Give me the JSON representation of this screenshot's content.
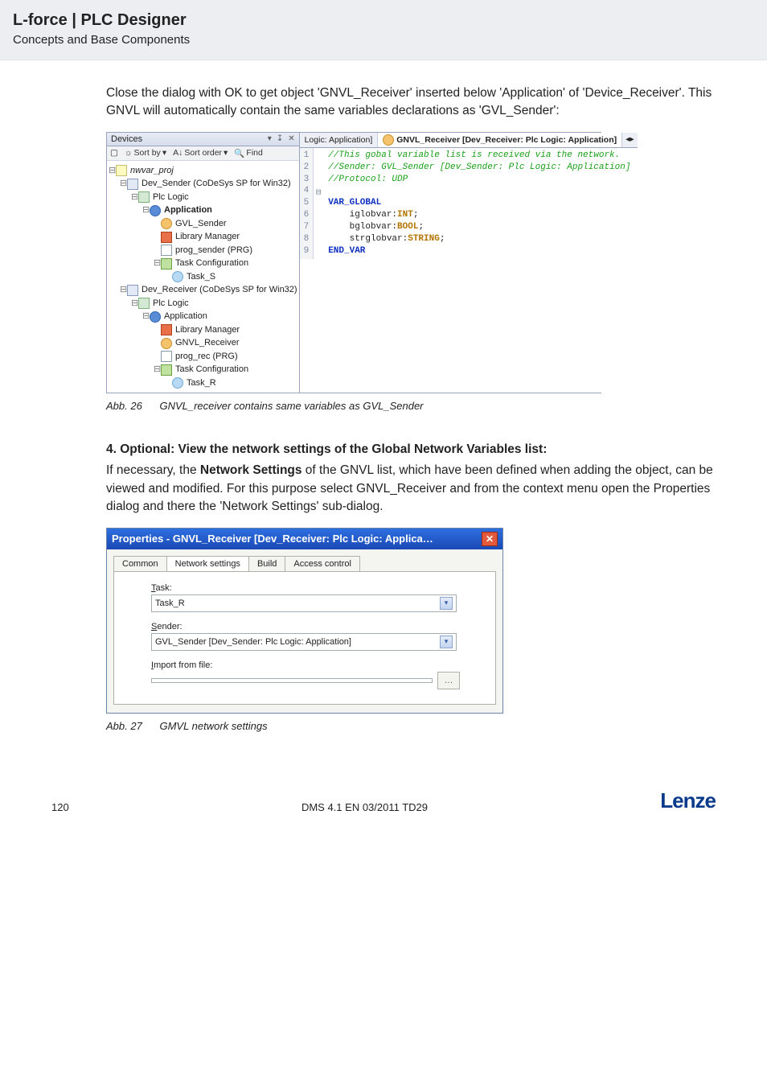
{
  "header": {
    "title": "L-force | PLC Designer",
    "subtitle": "Concepts and Base Components"
  },
  "para1": "Close the dialog with OK to get object 'GNVL_Receiver' inserted below 'Application' of 'Device_Receiver'. This GNVL will automatically contain the same variables declarations as 'GVL_Sender':",
  "ide": {
    "devices_title": "Devices",
    "toolbar": {
      "sort_by": "Sort by",
      "sort_order": "Sort order",
      "find": "Find"
    },
    "tree": {
      "project": "nwvar_proj",
      "dev_sender": "Dev_Sender (CoDeSys SP for Win32)",
      "plc_logic": "Plc Logic",
      "application": "Application",
      "gvl_sender": "GVL_Sender",
      "library_manager": "Library Manager",
      "prog_sender": "prog_sender (PRG)",
      "task_config": "Task Configuration",
      "task_s": "Task_S",
      "dev_receiver": "Dev_Receiver (CoDeSys SP for Win32)",
      "gnvl_receiver": "GNVL_Receiver",
      "prog_rec": "prog_rec (PRG)",
      "task_r": "Task_R"
    },
    "tabs": {
      "left": "Logic: Application]",
      "active": "GNVL_Receiver [Dev_Receiver: Plc Logic: Application]"
    },
    "code": {
      "l1": "//This gobal variable list is received via the network.",
      "l2": "//Sender: GVL_Sender [Dev_Sender: Plc Logic: Application]",
      "l3": "//Protocol: UDP",
      "l5a": "VAR_GLOBAL",
      "l6a": "iglobvar:",
      "l6b": "INT",
      "l6c": ";",
      "l7a": "bglobvar:",
      "l7b": "BOOL",
      "l7c": ";",
      "l8a": "strglobvar:",
      "l8b": "STRING",
      "l8c": ";",
      "l9": "END_VAR"
    }
  },
  "caption1": {
    "num": "Abb. 26",
    "text": "GNVL_receiver contains same variables as GVL_Sender"
  },
  "section4_title": "4. Optional: View the network settings of the Global Network Variables list:",
  "para2_a": "If necessary, the ",
  "para2_b": "Network Settings",
  "para2_c": " of the GNVL list, which have been defined when adding the object, can be viewed and modified. For this purpose select GNVL_Receiver and from the context menu open the Properties dialog and there the 'Network Settings' sub-dialog.",
  "dialog": {
    "title": "Properties - GNVL_Receiver [Dev_Receiver: Plc Logic: Applica…",
    "tabs": {
      "common": "Common",
      "network": "Network settings",
      "build": "Build",
      "access": "Access control"
    },
    "task_label": "Task:",
    "task_value": "Task_R",
    "sender_label": "Sender:",
    "sender_value": "GVL_Sender [Dev_Sender: Plc Logic: Application]",
    "import_label": "Import from file:",
    "import_value": ""
  },
  "caption2": {
    "num": "Abb. 27",
    "text": "GMVL network settings"
  },
  "footer": {
    "page": "120",
    "docid": "DMS 4.1 EN 03/2011 TD29",
    "logo": "Lenze"
  }
}
